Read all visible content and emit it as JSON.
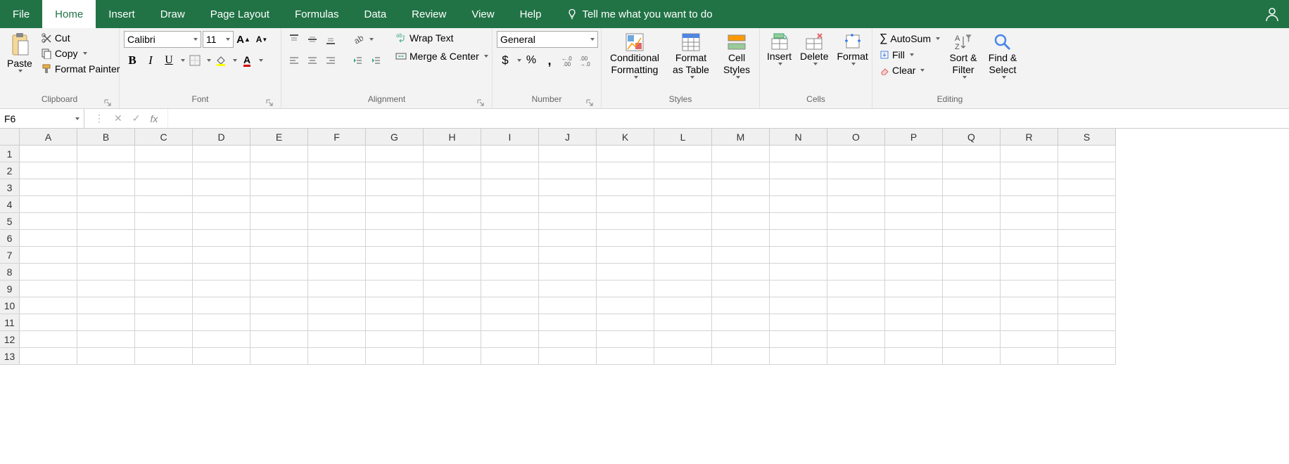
{
  "tabs": [
    "File",
    "Home",
    "Insert",
    "Draw",
    "Page Layout",
    "Formulas",
    "Data",
    "Review",
    "View",
    "Help"
  ],
  "active_tab": "Home",
  "tell_me": "Tell me what you want to do",
  "clipboard": {
    "paste": "Paste",
    "cut": "Cut",
    "copy": "Copy",
    "format_painter": "Format Painter",
    "label": "Clipboard"
  },
  "font": {
    "name": "Calibri",
    "size": "11",
    "label": "Font"
  },
  "alignment": {
    "wrap": "Wrap Text",
    "merge": "Merge & Center",
    "label": "Alignment"
  },
  "number": {
    "format": "General",
    "label": "Number"
  },
  "styles": {
    "cond": "Conditional Formatting",
    "table": "Format as Table",
    "cell": "Cell Styles",
    "label": "Styles"
  },
  "cells": {
    "insert": "Insert",
    "delete": "Delete",
    "format": "Format",
    "label": "Cells"
  },
  "editing": {
    "sum": "AutoSum",
    "fill": "Fill",
    "clear": "Clear",
    "sort": "Sort & Filter",
    "find": "Find & Select",
    "label": "Editing"
  },
  "name_box": "F6",
  "columns": [
    "A",
    "B",
    "C",
    "D",
    "E",
    "F",
    "G",
    "H",
    "I",
    "J",
    "K",
    "L",
    "M",
    "N",
    "O",
    "P",
    "Q",
    "R",
    "S"
  ],
  "rows": [
    "1",
    "2",
    "3",
    "4",
    "5",
    "6",
    "7",
    "8",
    "9",
    "10",
    "11",
    "12",
    "13"
  ]
}
